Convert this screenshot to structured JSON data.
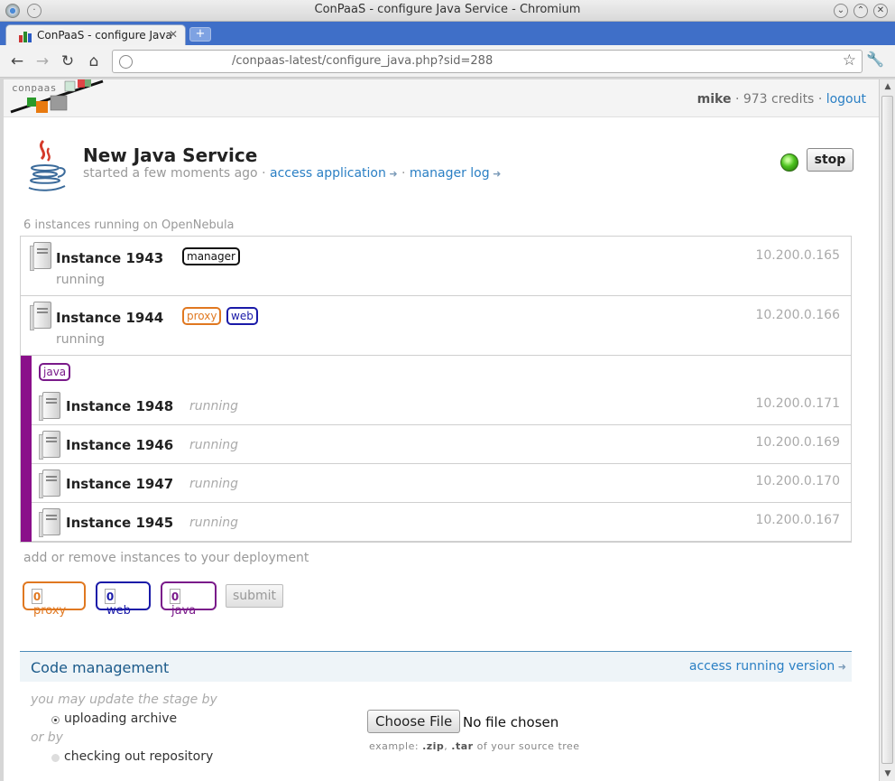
{
  "window": {
    "title": "ConPaaS - configure Java Service - Chromium"
  },
  "browser": {
    "tab_title": "ConPaaS - configure Java",
    "url": "/conpaas-latest/configure_java.php?sid=288"
  },
  "header": {
    "logo_text": "conpaas",
    "username": "mike",
    "separator": "·",
    "credits": "973 credits",
    "logout": "logout"
  },
  "service": {
    "title": "New Java Service",
    "started": "started a few moments ago",
    "access_application": "access application",
    "manager_log": "manager log",
    "stop_label": "stop",
    "status_color": "#4cc21e"
  },
  "instances": {
    "caption": "6 instances running on OpenNebula",
    "rows": [
      {
        "name": "Instance 1943",
        "status": "running",
        "ip": "10.200.0.165",
        "tags": [
          "manager"
        ]
      },
      {
        "name": "Instance 1944",
        "status": "running",
        "ip": "10.200.0.166",
        "tags": [
          "proxy",
          "web"
        ]
      }
    ],
    "group": {
      "tag": "java",
      "color": "#8a0f8a",
      "rows": [
        {
          "name": "Instance 1948",
          "status": "running",
          "ip": "10.200.0.171"
        },
        {
          "name": "Instance 1946",
          "status": "running",
          "ip": "10.200.0.169"
        },
        {
          "name": "Instance 1947",
          "status": "running",
          "ip": "10.200.0.170"
        },
        {
          "name": "Instance 1945",
          "status": "running",
          "ip": "10.200.0.167"
        }
      ]
    }
  },
  "scaling": {
    "caption": "add or remove instances to your deployment",
    "proxy": {
      "value": "0",
      "label": "proxy"
    },
    "web": {
      "value": "0",
      "label": "web"
    },
    "java": {
      "value": "0",
      "label": "java"
    },
    "submit": "submit"
  },
  "code": {
    "title": "Code management",
    "access_running": "access running version",
    "update_prompt": "you may update the stage by",
    "option_upload": "uploading archive",
    "or_by": "or by",
    "option_checkout": "checking out repository",
    "choose_file": "Choose File",
    "no_file": "No file chosen",
    "hint_prefix": "example:",
    "hint_zip": ".zip",
    "hint_sep": ",",
    "hint_tar": ".tar",
    "hint_suffix": "of your source tree"
  },
  "colors": {
    "proxy": "#e07820",
    "web": "#1a1aa8",
    "java": "#7a1a8a",
    "link": "#2a7fc4"
  }
}
